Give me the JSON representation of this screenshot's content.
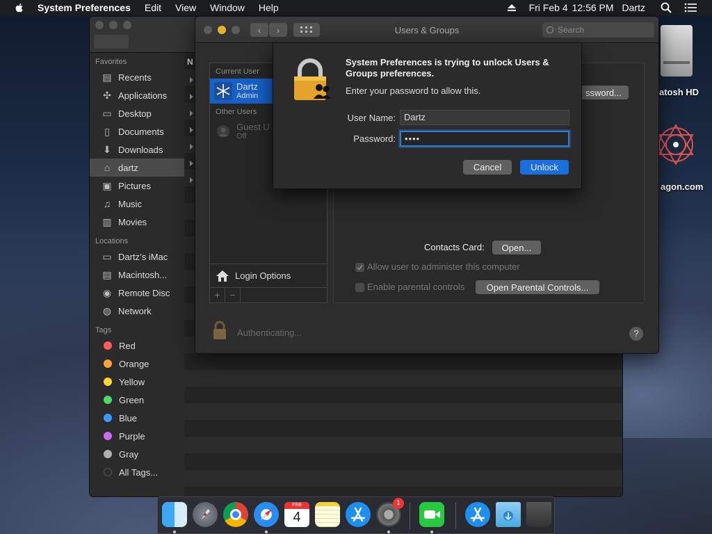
{
  "menubar": {
    "app_name": "System Preferences",
    "menus": [
      "Edit",
      "View",
      "Window",
      "Help"
    ],
    "date": "Fri Feb 4",
    "time": "12:56 PM",
    "user": "Dartz"
  },
  "finder": {
    "column_header": "N",
    "sidebar": {
      "favorites_header": "Favorites",
      "favorites": [
        {
          "label": "Recents",
          "icon": "recents-icon"
        },
        {
          "label": "Applications",
          "icon": "applications-icon"
        },
        {
          "label": "Desktop",
          "icon": "desktop-icon"
        },
        {
          "label": "Documents",
          "icon": "documents-icon"
        },
        {
          "label": "Downloads",
          "icon": "downloads-icon"
        },
        {
          "label": "dartz",
          "icon": "home-icon"
        },
        {
          "label": "Pictures",
          "icon": "pictures-icon"
        },
        {
          "label": "Music",
          "icon": "music-icon"
        },
        {
          "label": "Movies",
          "icon": "movies-icon"
        }
      ],
      "locations_header": "Locations",
      "locations": [
        {
          "label": "Dartz’s iMac",
          "icon": "imac-icon"
        },
        {
          "label": "Macintosh...",
          "icon": "disk-icon"
        },
        {
          "label": "Remote Disc",
          "icon": "disc-icon"
        },
        {
          "label": "Network",
          "icon": "network-icon"
        }
      ],
      "tags_header": "Tags",
      "tags": [
        {
          "label": "Red",
          "color": "#ff5b5b"
        },
        {
          "label": "Orange",
          "color": "#ffa23a"
        },
        {
          "label": "Yellow",
          "color": "#ffd43a"
        },
        {
          "label": "Green",
          "color": "#4cd964"
        },
        {
          "label": "Blue",
          "color": "#3a9bff"
        },
        {
          "label": "Purple",
          "color": "#c86bf0"
        },
        {
          "label": "Gray",
          "color": "#b0b0b0"
        },
        {
          "label": "All Tags...",
          "color": "#555555"
        }
      ]
    }
  },
  "desktop": {
    "disk_label": "atosh HD",
    "site_label": "agon.com"
  },
  "prefs": {
    "title": "Users & Groups",
    "search_placeholder": "Search",
    "current_user_header": "Current User",
    "current_user": {
      "name": "Dartz",
      "role": "Admin"
    },
    "other_users_header": "Other Users",
    "guest_user": {
      "name": "Guest U",
      "status": "Off"
    },
    "login_options": "Login Options",
    "plus": "+",
    "minus": "−",
    "change_password_btn": "ssword...",
    "contacts_card_label": "Contacts Card:",
    "open_btn": "Open...",
    "allow_admin_label": "Allow user to administer this computer",
    "parental_label": "Enable parental controls",
    "open_parental_btn": "Open Parental Controls...",
    "auth_status": "Authenticating...",
    "help": "?"
  },
  "dialog": {
    "message": "System Preferences is trying to unlock Users & Groups preferences.",
    "sub": "Enter your password to allow this.",
    "username_label": "User Name:",
    "username_value": "Dartz",
    "password_label": "Password:",
    "password_value": "••••",
    "cancel": "Cancel",
    "unlock": "Unlock",
    "accent": "#1a6fdc"
  },
  "dock": {
    "calendar_month": "FEB",
    "calendar_day": "4",
    "badge": "1",
    "apps": [
      "Finder",
      "Launchpad",
      "Chrome",
      "Safari",
      "Calendar",
      "Notes",
      "App Store",
      "System Preferences",
      "FaceTime",
      "App Store Downloads",
      "Downloads",
      "Trash"
    ]
  }
}
